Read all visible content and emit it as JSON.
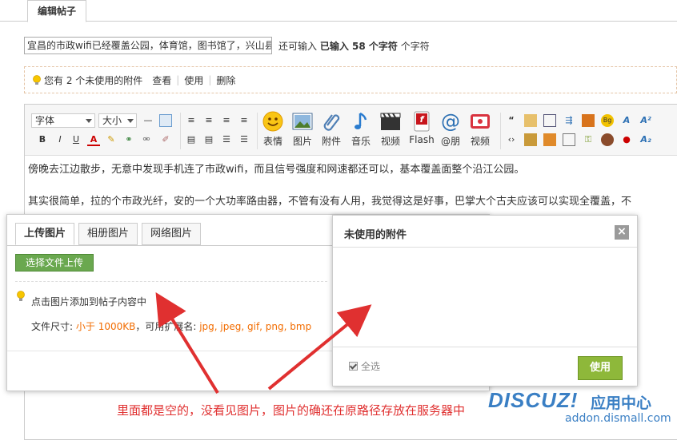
{
  "tabs": {
    "active_label": "编辑帖子"
  },
  "title": {
    "value": "宜昌的市政wifi已经覆盖公园，体育馆，图书馆了，兴山县",
    "count_prefix": "还可输入",
    "count_entered": "已输入 58 个字符",
    "count_suffix": "个字符"
  },
  "unused_bar": {
    "text": "您有 2 个未使用的附件",
    "view": "查看",
    "use": "使用",
    "delete": "删除"
  },
  "toolbar": {
    "font_select": "字体",
    "size_select": "大小",
    "emoticon": "表情",
    "image": "图片",
    "attachment": "附件",
    "music": "音乐",
    "video": "视频",
    "flash": "Flash",
    "mention": "@朋",
    "video2": "视频",
    "small_row2": [
      "B",
      "I",
      "U",
      "A"
    ]
  },
  "content": {
    "para1": "傍晚去江边散步，无意中发现手机连了市政wifi，而且信号强度和网速都还可以，基本覆盖面整个沿江公园。",
    "para2": "其实很简单，拉的个市政光纤，安的一个大功率路由器，不管有没有人用，我觉得这是好事，巴掌大个古夫应该可以实现全覆盖，不",
    "para3": "…"
  },
  "upload_dialog": {
    "tabs": [
      "上传图片",
      "相册图片",
      "网络图片"
    ],
    "upload_button": "选择文件上传",
    "tip": "点击图片添加到帖子内容中",
    "size_prefix": "文件尺寸:",
    "size_limit": "小于 1000KB",
    "ext_prefix": "，可用扩展名:",
    "ext_list": "jpg, jpeg, gif, png, bmp"
  },
  "unused_dialog": {
    "title": "未使用的附件",
    "close": "×",
    "select_all": "全选",
    "use_button": "使用"
  },
  "annotation": "里面都是空的，没看见图片，图片的确还在原路径存放在服务器中",
  "watermark": {
    "logo": "DISCUZ!",
    "cn": "应用中心",
    "url": "addon.dismall.com"
  },
  "colors": {
    "accent_orange": "#f26c00",
    "annotation_red": "#e03030",
    "green_button": "#8eb83a",
    "watermark_blue": "#3a7fc4"
  }
}
